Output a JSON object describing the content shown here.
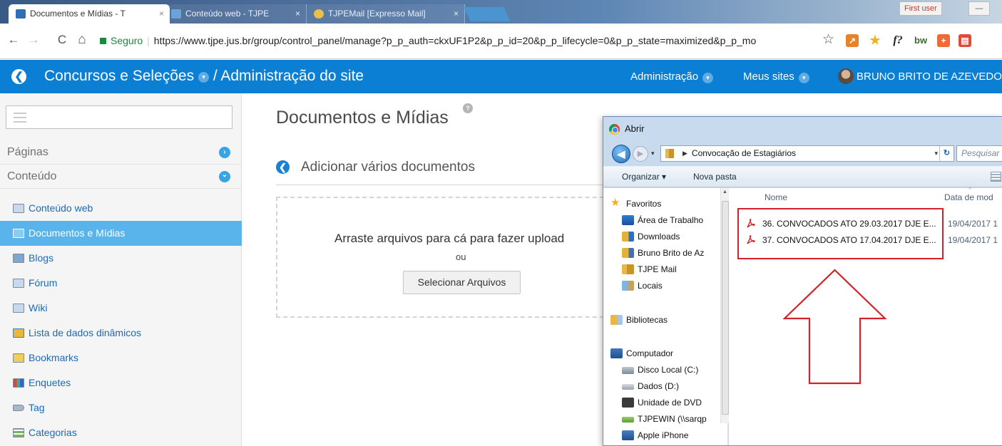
{
  "browser": {
    "tabs": [
      {
        "title": "Documentos e Mídias - T",
        "active": true
      },
      {
        "title": "Conteúdo web - TJPE",
        "active": false
      },
      {
        "title": "TJPEMail [Expresso Mail]",
        "active": false
      }
    ],
    "close_glyph": "×",
    "profile_label": "First user",
    "minimize_glyph": "—",
    "url": {
      "security_label": "Seguro",
      "text": "https://www.tjpe.jus.br/group/control_panel/manage?p_p_auth=ckxUF1P2&p_p_id=20&p_p_lifecycle=0&p_p_state=maximized&p_p_mo"
    },
    "nav": {
      "back": "←",
      "forward": "→",
      "reload": "C",
      "home": "⌂",
      "bookmark": "☆"
    },
    "extensions": [
      {
        "name": "chart-extension-icon",
        "glyph": "↗",
        "color": "#e8822a"
      },
      {
        "name": "star-extension-icon",
        "glyph": "★",
        "color": "#f2b01e"
      },
      {
        "name": "formula-extension-icon",
        "glyph": "f?",
        "color": "#ffffff"
      },
      {
        "name": "bw-extension-icon",
        "glyph": "bw",
        "color": "#ffffff"
      },
      {
        "name": "plus-extension-icon",
        "glyph": "+",
        "color": "#f06a35"
      },
      {
        "name": "note-extension-icon",
        "glyph": "▤",
        "color": "#e04a3a"
      }
    ]
  },
  "controlpanel": {
    "back_glyph": "❮",
    "site_name": "Concursos e Seleções",
    "separator": "/",
    "page": "Administração do site",
    "caret_glyph": "▾",
    "menu": {
      "admin": "Administração",
      "sites": "Meus sites",
      "user": "BRUNO BRITO DE AZEVEDO"
    },
    "bar_color": "#0a7fd4"
  },
  "sidebar": {
    "sections": [
      {
        "label": "Páginas",
        "glyph": "›"
      },
      {
        "label": "Conteúdo",
        "glyph": "⌄"
      }
    ],
    "items": [
      {
        "label": "Conteúdo web",
        "active": false
      },
      {
        "label": "Documentos e Mídias",
        "active": true
      },
      {
        "label": "Blogs",
        "active": false
      },
      {
        "label": "Fórum",
        "active": false
      },
      {
        "label": "Wiki",
        "active": false
      },
      {
        "label": "Lista de dados dinâmicos",
        "active": false
      },
      {
        "label": "Bookmarks",
        "active": false
      },
      {
        "label": "Enquetes",
        "active": false
      },
      {
        "label": "Tag",
        "active": false
      },
      {
        "label": "Categorias",
        "active": false
      }
    ],
    "active_color": "#5ab4ec"
  },
  "main": {
    "title": "Documentos e Mídias",
    "help_glyph": "?",
    "back_glyph": "❮",
    "subtitle": "Adicionar vários documentos",
    "drop_text": "Arraste arquivos para cá para fazer upload",
    "or_text": "ou",
    "select_button": "Selecionar Arquivos"
  },
  "dialog": {
    "title": "Abrir",
    "back_glyph": "◀",
    "forward_glyph": "▶",
    "caret_glyph": "▾",
    "path_separator": "▶",
    "path": "Convocação de Estagiários",
    "refresh_glyph": "↻",
    "search_placeholder": "Pesquisar",
    "organize": "Organizar ▾",
    "new_folder": "Nova pasta",
    "nav_tree": [
      {
        "label": "Favoritos",
        "kind": "star"
      },
      {
        "label": "Área de Trabalho",
        "kind": "desktop"
      },
      {
        "label": "Downloads",
        "kind": "downloads"
      },
      {
        "label": "Bruno Brito de Az",
        "kind": "user"
      },
      {
        "label": "TJPE Mail",
        "kind": "folder"
      },
      {
        "label": "Locais",
        "kind": "places"
      },
      {
        "label": "Bibliotecas",
        "kind": "libraries"
      },
      {
        "label": "Computador",
        "kind": "computer"
      },
      {
        "label": "Disco Local (C:)",
        "kind": "disk"
      },
      {
        "label": "Dados (D:)",
        "kind": "disk2"
      },
      {
        "label": "Unidade de DVD",
        "kind": "dvd"
      },
      {
        "label": "TJPEWIN (\\\\sarqp",
        "kind": "network"
      },
      {
        "label": "Apple iPhone",
        "kind": "phone"
      }
    ],
    "columns": {
      "name": "Nome",
      "date": "Data de mod"
    },
    "files": [
      {
        "name": "36. CONVOCADOS ATO 29.03.2017 DJE E...",
        "date": "19/04/2017 1"
      },
      {
        "name": "37. CONVOCADOS ATO 17.04.2017 DJE E...",
        "date": "19/04/2017 1"
      }
    ],
    "highlight_color": "#d2232a"
  }
}
